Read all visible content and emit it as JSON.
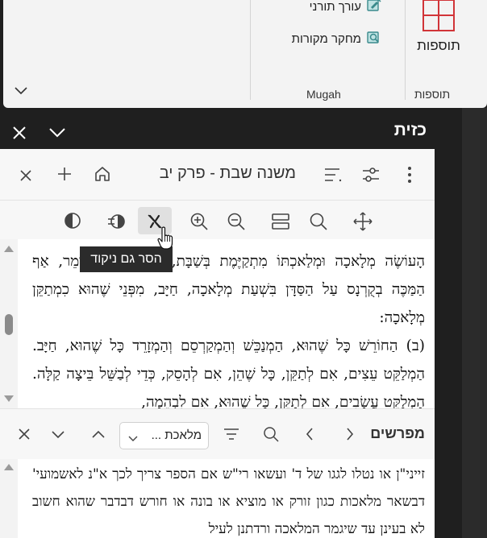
{
  "ribbon": {
    "items": [
      {
        "label": "עורך תורני",
        "icon": "book-edit-icon"
      },
      {
        "label": "מחקר מקורות",
        "icon": "book-search-icon"
      }
    ],
    "tosafot_button": {
      "label": "תוספות",
      "icon": "grid-icon"
    },
    "group_labels": {
      "mugah": "Mugah",
      "tosafot": "תוספות"
    }
  },
  "pane": {
    "title": "כזית"
  },
  "book_toolbar": {
    "title": "משנה שבת - פרק יב",
    "icons": [
      "kebab-menu-icon",
      "sliders-icon",
      "list-icon",
      "home-icon",
      "plus-icon",
      "close-icon"
    ]
  },
  "view_toolbar": {
    "icons": [
      "move-icon",
      "search-icon",
      "split-view-icon",
      "zoom-out-icon",
      "zoom-in-icon",
      "remove-nikud-icon",
      "toggle-icon",
      "contrast-icon"
    ]
  },
  "tooltip": "הסר גם ניקוד",
  "main_text": {
    "paragraphs": [
      "הָעוֹשֶׂה מְלָאכָה וּמְלַאכְתּוֹ מִתְקַיֶּמֶת בְּשַׁבָּת, בֶּן גַּמְלִיאֵל אוֹמֵר, אַף הַמַּכֶּה בְקֻרְנָס עַל הַסַּדָּן בִּשְׁעַת מְלָאכָה, חַיָּב, מִפְּנֵי שֶׁהוּא כִמְתַקֵּן מְלָאכָה:",
      "(ב) הַחוֹרֵשׁ כָּל שֶׁהוּא, הַמְנַכֵּשׁ וְהַמְקַרְסֵם וְהַמְזָרֵד כָּל שֶׁהוּא, חַיָּב. הַמְלַקֵּט עֵצִים, אִם לְתַקֵּן, כָּל שֶׁהֵן, אִם לְהָסֵק, כְּדֵי לְבַשֵּׁל בֵּיצָה קַלָּה. הַמְלַקֵּט עֲשָׂבִים, אִם לְתַקֵּן, כָּל שֶׁהוּא, אִם לִבְהֵמָה,"
    ]
  },
  "commentary_toolbar": {
    "title": "מפרשים",
    "filter_value": "מלאכת ...",
    "icons": [
      "chevron-left-icon",
      "chevron-left-icon",
      "search-icon",
      "filter-icon",
      "chevron-up-icon",
      "chevron-down-icon",
      "close-icon"
    ]
  },
  "commentary_text": "זייני\"ן או נטלו לגגו של ד' ועשאו רי\"ש אם הספר צריך לכך א\"נ לאשמועי' דבשאר מלאכות כגון זורק או מוציא או בונה או חורש דבדבר שהוא חשוב לא בעינן עד שיגמר המלאכה ורדתנן לעיל",
  "colors": {
    "accent_red": "#d13438",
    "icon_teal": "#3a8a8c",
    "tooltip_bg": "#2b2b2b"
  }
}
